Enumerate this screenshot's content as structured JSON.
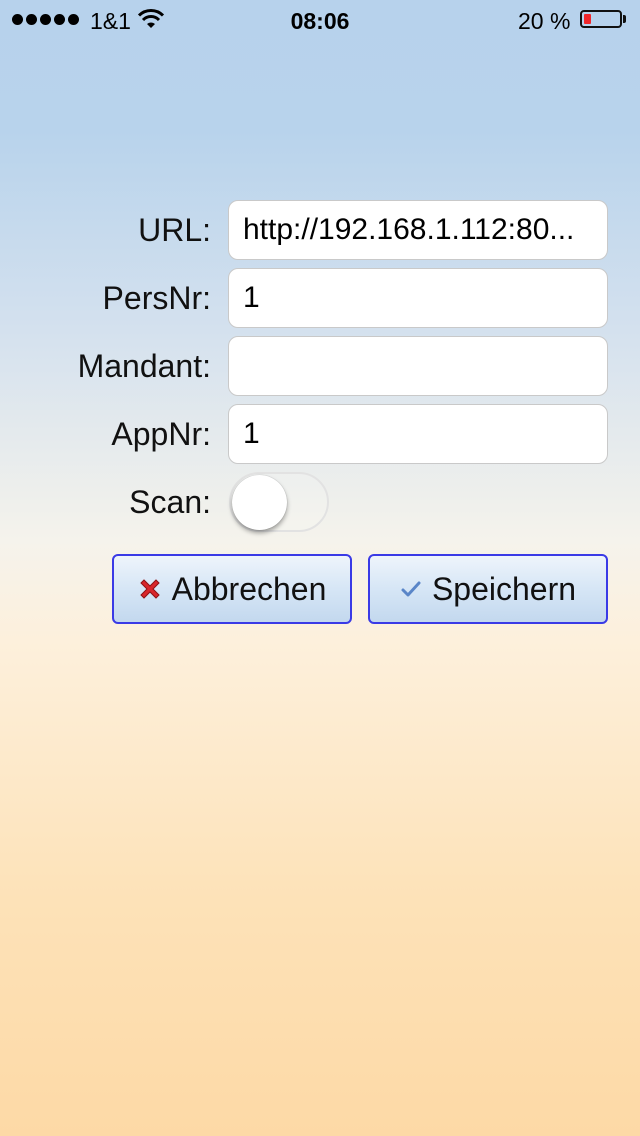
{
  "status": {
    "carrier": "1&1",
    "time": "08:06",
    "battery_percent": "20 %",
    "battery_level": 0.2,
    "signal_dots": 5
  },
  "form": {
    "url_label": "URL:",
    "url_value": "http://192.168.1.112:80...",
    "persnr_label": "PersNr:",
    "persnr_value": "1",
    "mandant_label": "Mandant:",
    "mandant_value": "",
    "appnr_label": "AppNr:",
    "appnr_value": "1",
    "scan_label": "Scan:",
    "scan_enabled": false
  },
  "buttons": {
    "cancel_label": "Abbrechen",
    "save_label": "Speichern"
  },
  "colors": {
    "button_border": "#3a3ae6",
    "battery_low": "#f0262a",
    "cancel_icon": "#d9262b",
    "check_icon": "#5a86c8"
  }
}
